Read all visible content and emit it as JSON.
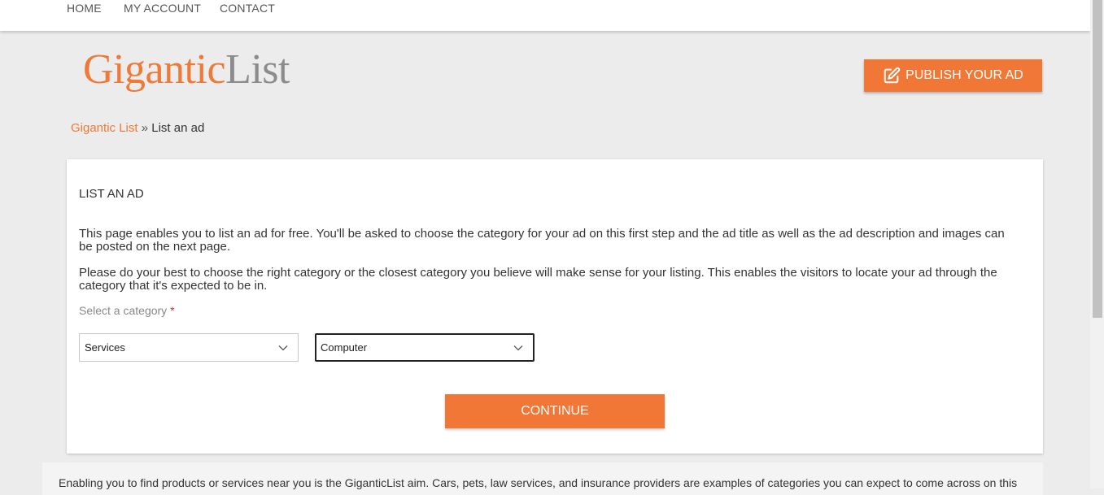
{
  "nav": {
    "items": [
      {
        "label": "HOME"
      },
      {
        "label": "MY ACCOUNT"
      },
      {
        "label": "CONTACT"
      }
    ]
  },
  "logo": {
    "part1": "Gigantic",
    "part2": "List"
  },
  "header": {
    "publish_label": "PUBLISH YOUR AD",
    "publish_icon": "edit-icon"
  },
  "breadcrumb": {
    "home": "Gigantic List",
    "separator": "»",
    "current": "List an ad"
  },
  "form": {
    "title": "LIST AN AD",
    "paragraph1": "This page enables you to list an ad for free. You'll be asked to choose the category for your ad on this first step and the ad title as well as the ad description and images can be posted on the next page.",
    "paragraph2": "Please do your best to choose the right category or the closest category you believe will make sense for your listing. This enables the visitors to locate your ad through the category that it's expected to be in.",
    "category_label": "Select a category",
    "required_mark": "*",
    "category_value": "Services",
    "subcategory_value": "Computer",
    "continue_label": "CONTINUE"
  },
  "footer": {
    "text": "Enabling you to find products or services near you is the GiganticList aim. Cars, pets, law services, and insurance providers are examples of categories you can expect to come across on this"
  },
  "colors": {
    "accent": "#f07735",
    "logo_gray": "#8c8c8c",
    "background": "#ececec"
  }
}
